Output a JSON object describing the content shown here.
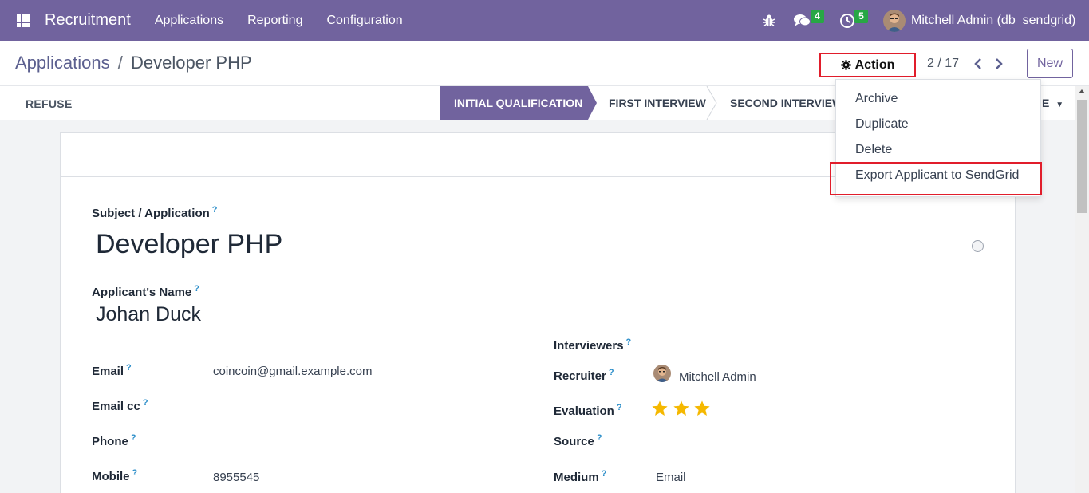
{
  "navbar": {
    "brand": "Recruitment",
    "menus": [
      "Applications",
      "Reporting",
      "Configuration"
    ],
    "messages_badge": "4",
    "activities_badge": "5",
    "user": "Mitchell Admin (db_sendgrid)",
    "bg_color": "#71639e"
  },
  "control": {
    "breadcrumb_parent": "Applications",
    "breadcrumb_separator": "/",
    "breadcrumb_current": "Developer PHP",
    "action_label": "Action",
    "pager": "2 / 17",
    "new_label": "New"
  },
  "statusbar": {
    "refuse_label": "REFUSE",
    "stages": [
      "INITIAL QUALIFICATION",
      "FIRST INTERVIEW",
      "SECOND INTERVIEW"
    ],
    "active_stage": "INITIAL QUALIFICATION",
    "more_suffix": "E"
  },
  "dropdown": {
    "items": [
      "Archive",
      "Duplicate",
      "Delete",
      "Export Applicant to SendGrid"
    ]
  },
  "form": {
    "subject_label": "Subject / Application",
    "subject_value": "Developer PHP",
    "applicant_label": "Applicant's Name",
    "applicant_value": "Johan Duck",
    "help_mark": "?",
    "email_label": "Email",
    "email_value": "coincoin@gmail.example.com",
    "email_cc_label": "Email cc",
    "phone_label": "Phone",
    "mobile_label": "Mobile",
    "mobile_value": "8955545",
    "interviewers_label": "Interviewers",
    "recruiter_label": "Recruiter",
    "recruiter_value": "Mitchell Admin",
    "evaluation_label": "Evaluation",
    "evaluation_stars": 3,
    "source_label": "Source",
    "medium_label": "Medium",
    "medium_value": "Email"
  },
  "colors": {
    "accent": "#71639e",
    "highlight_border": "#e11d2b",
    "star": "#f5b800",
    "badge": "#28a745"
  }
}
